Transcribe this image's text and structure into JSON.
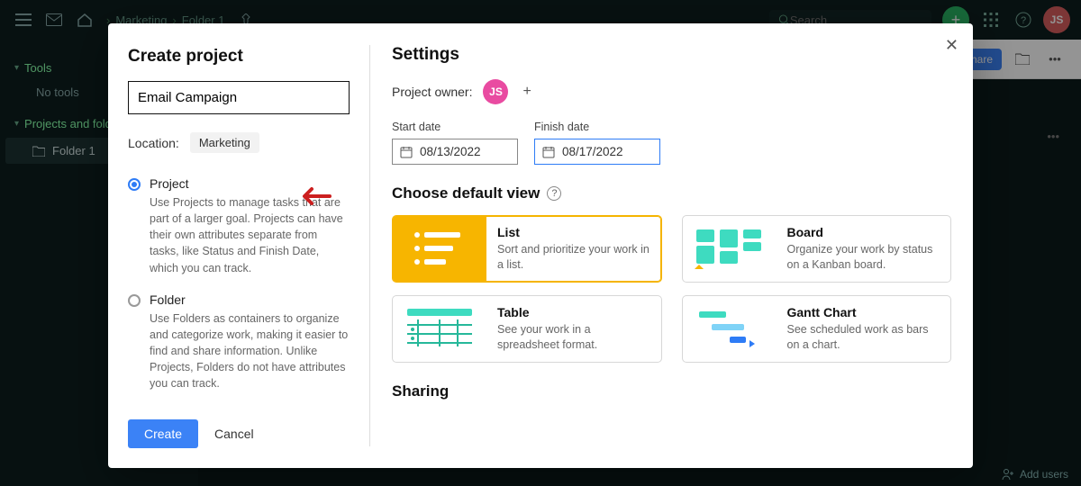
{
  "header": {
    "breadcrumb": [
      "Marketing",
      "Folder 1"
    ],
    "search_placeholder": "Search",
    "avatar_initials": "JS"
  },
  "content_bar": {
    "share_label": "Share"
  },
  "sidebar": {
    "tools_label": "Tools",
    "no_tools": "No tools",
    "projects_label": "Projects and folders",
    "folder_item": "Folder 1"
  },
  "footer": {
    "add_users": "Add users"
  },
  "modal": {
    "left": {
      "title": "Create project",
      "name_value": "Email Campaign",
      "location_label": "Location:",
      "location_value": "Marketing",
      "project_radio": {
        "label": "Project",
        "desc": "Use Projects to manage tasks that are part of a larger goal. Projects can have their own attributes separate from tasks, like Status and Finish Date, which you can track."
      },
      "folder_radio": {
        "label": "Folder",
        "desc": "Use Folders as containers to organize and categorize work, making it easier to find and share information. Unlike Projects, Folders do not have attributes you can track."
      },
      "create_btn": "Create",
      "cancel_btn": "Cancel"
    },
    "right": {
      "settings_title": "Settings",
      "owner_label": "Project owner:",
      "owner_initials": "JS",
      "start_label": "Start date",
      "start_value": "08/13/2022",
      "finish_label": "Finish date",
      "finish_value": "08/17/2022",
      "default_view_title": "Choose default view",
      "views": {
        "list": {
          "title": "List",
          "desc": "Sort and prioritize your work in a list."
        },
        "board": {
          "title": "Board",
          "desc": "Organize your work by status on a Kanban board."
        },
        "table": {
          "title": "Table",
          "desc": "See your work in a spreadsheet format."
        },
        "gantt": {
          "title": "Gantt Chart",
          "desc": "See scheduled work as bars on a chart."
        }
      },
      "sharing_title": "Sharing"
    }
  }
}
